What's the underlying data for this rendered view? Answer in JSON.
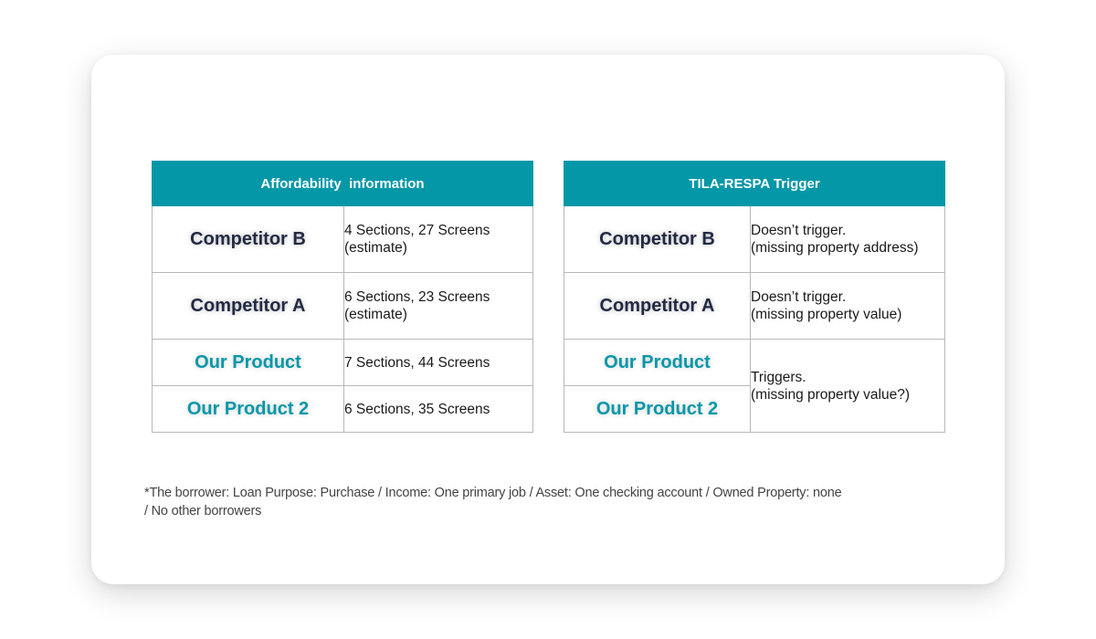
{
  "affordability_table": {
    "header": "Affordability  information",
    "rows": [
      {
        "product": "Competitor B",
        "line1": "4 Sections, 27 Screens",
        "line2": "(estimate)"
      },
      {
        "product": "Competitor A",
        "line1": "6 Sections, 23 Screens",
        "line2": "(estimate)"
      },
      {
        "product": "Our Product",
        "line1": "7 Sections, 44 Screens"
      },
      {
        "product": "Our Product 2",
        "line1": "6 Sections, 35 Screens"
      }
    ]
  },
  "trigger_table": {
    "header": "TILA-RESPA Trigger",
    "rows": [
      {
        "product": "Competitor B",
        "line1": "Doesn’t trigger.",
        "line2": "(missing property address)"
      },
      {
        "product": "Competitor A",
        "line1": "Doesn’t trigger.",
        "line2": "(missing property value)"
      },
      {
        "product": "Our Product",
        "line1": "Triggers.",
        "line2": "(missing property value?)"
      },
      {
        "product": "Our Product 2"
      }
    ]
  },
  "footnote": {
    "line1": "*The borrower: Loan Purpose: Purchase / Income: One primary job / Asset: One checking account / Owned Property: none",
    "line2": "/ No other borrowers"
  },
  "colors": {
    "accent": "#0497a8",
    "competitor_text": "#222a44",
    "border": "#b8b8b8"
  }
}
